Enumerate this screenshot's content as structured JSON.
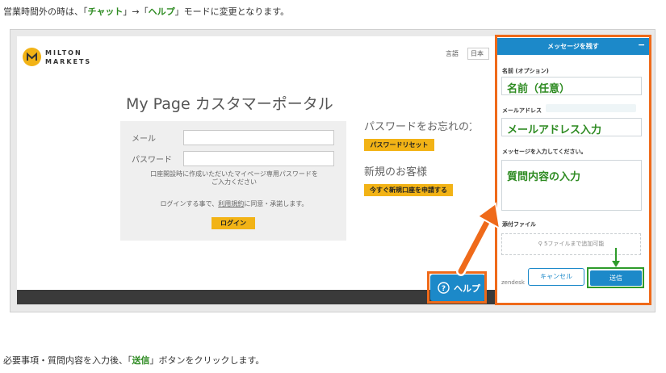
{
  "instructions": {
    "top": {
      "prefix": "営業時間外の時は、",
      "q1": "「",
      "chat": "チャット",
      "arrow": "」→「",
      "help": "ヘルプ",
      "suffix": "」モードに変更となります。"
    },
    "bottom": {
      "prefix": "必要事項・質問内容を入力後、",
      "q1": "「",
      "send": "送信",
      "suffix": "」ボタンをクリックします。"
    }
  },
  "site": {
    "logo_line1": "MILTON",
    "logo_line2": "MARKETS",
    "language_label": "言語",
    "language_value": "日本",
    "page_title": "My Page カスタマーポータル",
    "login": {
      "email_label": "メール",
      "password_label": "パスワード",
      "note_line1": "口座開設時に作成いただいたマイページ専用パスワードを",
      "note_line2": "ご入力ください",
      "terms_prefix": "ログインする事で、",
      "terms_link": "利用規約",
      "terms_suffix": "に同意・承諾します。",
      "login_button": "ログイン"
    },
    "forgot_heading": "パスワードをお忘れの方",
    "reset_button": "パスワードリセット",
    "new_customer_heading": "新規のお客様",
    "open_account_button": "今すぐ新規口座を申請する"
  },
  "help_button": {
    "label": "ヘルプ",
    "icon": "question-circle-icon"
  },
  "widget": {
    "header": "メッセージを残す",
    "minimize": "−",
    "name_label": "名前 (オプション)",
    "name_annotation": "名前（任意）",
    "email_label": "メールアドレス",
    "email_annotation": "メールアドレス入力",
    "message_label": "メッセージを入力してください。",
    "message_annotation": "質問内容の入力",
    "attachment_label": "添付ファイル",
    "attachment_hint": "5ファイルまで追加可能",
    "zendesk": "zendesk",
    "cancel_button": "キャンセル",
    "send_button": "送信"
  },
  "colors": {
    "accent": "#1c89c9",
    "highlight": "#ef6a1a",
    "annotation_green": "#2e8b22",
    "brand_yellow": "#f2b316"
  }
}
